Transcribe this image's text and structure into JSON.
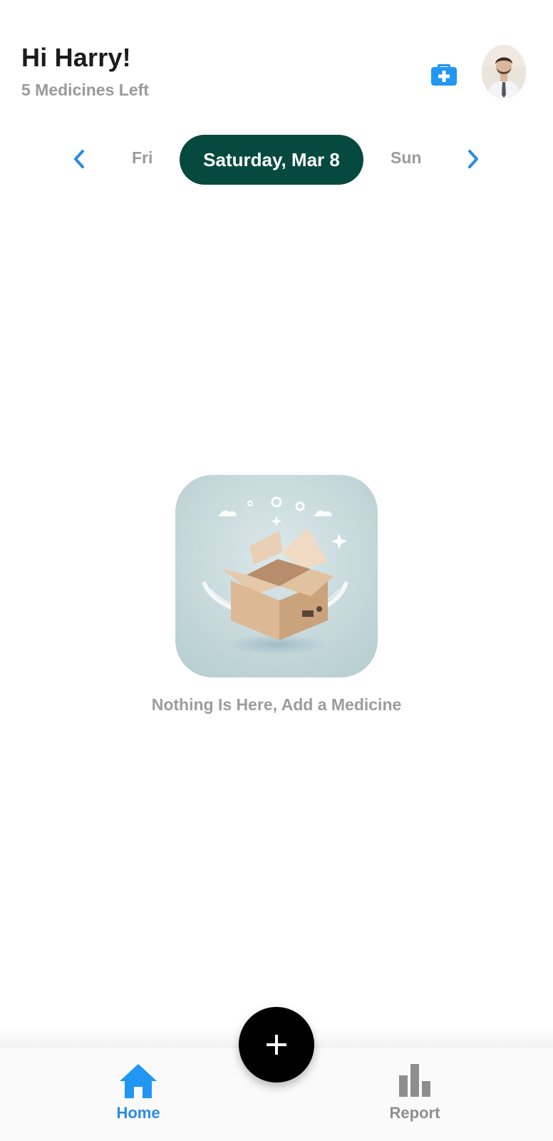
{
  "header": {
    "greeting": "Hi Harry!",
    "subtitle": "5 Medicines Left",
    "kit_icon": "medical-kit-icon",
    "avatar_icon": "user-avatar"
  },
  "date_selector": {
    "prev_day": "Fri",
    "selected_day": "Saturday, Mar 8",
    "next_day": "Sun",
    "prev_icon": "chevron-left-icon",
    "next_icon": "chevron-right-icon"
  },
  "empty_state": {
    "message": "Nothing Is Here, Add a Medicine",
    "illustration": "open-box-illustration"
  },
  "bottom_nav": {
    "items": [
      {
        "label": "Home",
        "icon": "home-icon",
        "active": true
      },
      {
        "label": "Report",
        "icon": "bar-chart-icon",
        "active": false
      }
    ],
    "fab_icon": "plus-icon"
  },
  "colors": {
    "accent_blue": "#2b8ae6",
    "selected_pill": "#064a3f",
    "muted_text": "#9a9a9a",
    "fab": "#000000"
  }
}
